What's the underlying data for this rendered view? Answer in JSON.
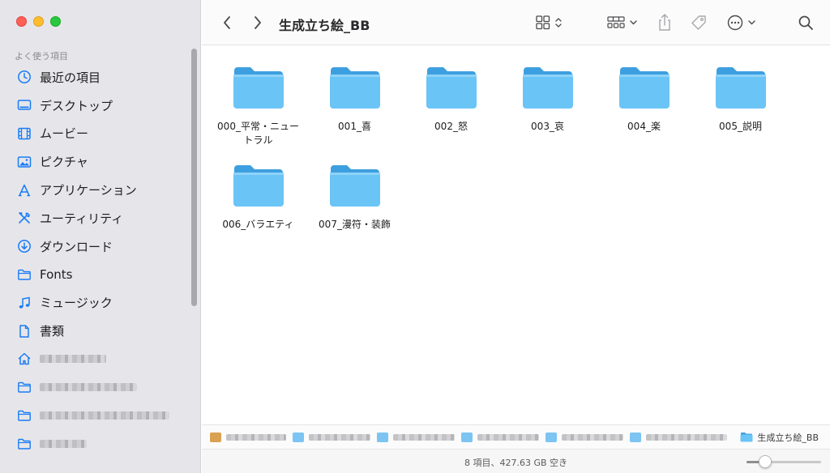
{
  "window": {
    "title": "生成立ち絵_BB"
  },
  "sidebar": {
    "section_title": "よく使う項目",
    "items": [
      {
        "label": "最近の項目",
        "icon": "clock-icon"
      },
      {
        "label": "デスクトップ",
        "icon": "desktop-icon"
      },
      {
        "label": "ムービー",
        "icon": "film-icon"
      },
      {
        "label": "ピクチャ",
        "icon": "photo-icon"
      },
      {
        "label": "アプリケーション",
        "icon": "apps-icon"
      },
      {
        "label": "ユーティリティ",
        "icon": "tools-icon"
      },
      {
        "label": "ダウンロード",
        "icon": "download-icon"
      },
      {
        "label": "Fonts",
        "icon": "folder-icon"
      },
      {
        "label": "ミュージック",
        "icon": "music-note-icon"
      },
      {
        "label": "書類",
        "icon": "document-icon"
      }
    ],
    "redacted_items": [
      {
        "icon": "home-icon"
      },
      {
        "icon": "folder-icon"
      },
      {
        "icon": "folder-icon"
      },
      {
        "icon": "folder-icon"
      }
    ]
  },
  "toolbar": {
    "back_icon": "chevron-left-icon",
    "forward_icon": "chevron-right-icon",
    "view_icon": "grid-view-icon",
    "group_icon": "group-by-icon",
    "share_icon": "share-icon",
    "tag_icon": "tag-icon",
    "more_icon": "ellipsis-circle-icon",
    "search_icon": "search-icon"
  },
  "files": [
    {
      "name": "000_平常・ニュートラル"
    },
    {
      "name": "001_喜"
    },
    {
      "name": "002_怒"
    },
    {
      "name": "003_哀"
    },
    {
      "name": "004_楽"
    },
    {
      "name": "005_説明"
    },
    {
      "name": "006_バラエティ"
    },
    {
      "name": "007_漫符・装飾"
    }
  ],
  "pathbar": {
    "current": "生成立ち絵_BB"
  },
  "status": {
    "text": "8 項目、427.63 GB 空き",
    "zoom_fraction": 0.2
  },
  "colors": {
    "accent": "#1a7cf5",
    "folder_front": "#6ac4f6",
    "folder_back": "#3d9fe0",
    "sidebar_bg": "#e6e6ea"
  }
}
